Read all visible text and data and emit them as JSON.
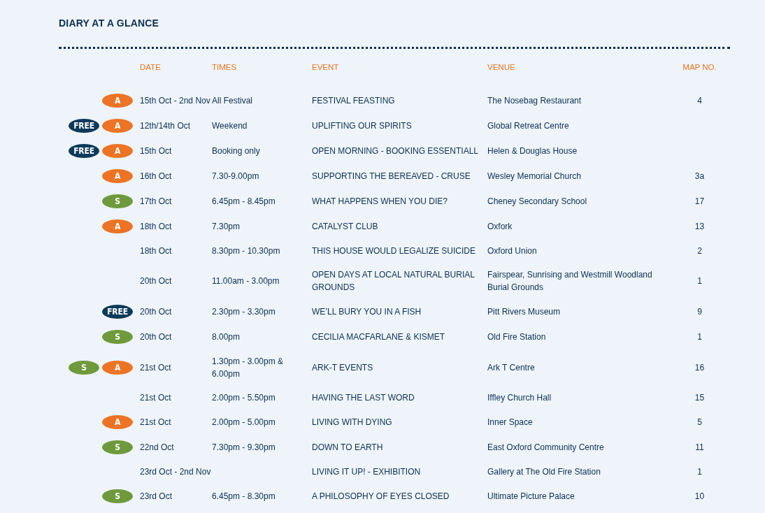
{
  "title": "DIARY AT A GLANCE",
  "columns": [
    "DATE",
    "TIMES",
    "EVENT",
    "VENUE",
    "MAP NO."
  ],
  "rows": [
    {
      "badges": [
        {
          "kind": "arts",
          "label": "A"
        }
      ],
      "date": "15th Oct - 2nd Nov",
      "times": "All Festival",
      "event": "FESTIVAL FEASTING",
      "venue": "The Nosebag Restaurant",
      "map_no": "4"
    },
    {
      "badges": [
        {
          "kind": "free",
          "label": "FREE"
        },
        {
          "kind": "arts",
          "label": "A"
        }
      ],
      "date": "12th/14th Oct",
      "times": "Weekend",
      "event": "UPLIFTING OUR SPIRITS",
      "venue": "Global Retreat Centre",
      "map_no": ""
    },
    {
      "badges": [
        {
          "kind": "free",
          "label": "FREE"
        },
        {
          "kind": "arts",
          "label": "A"
        }
      ],
      "date": "15th Oct",
      "times": "Booking only",
      "event": "OPEN MORNING - BOOKING ESSENTIALL",
      "venue": "Helen & Douglas House",
      "map_no": ""
    },
    {
      "badges": [
        {
          "kind": "arts",
          "label": "A"
        }
      ],
      "date": "16th Oct",
      "times": "7.30-9.00pm",
      "event": "SUPPORTING THE BEREAVED - CRUSE",
      "venue": "Wesley Memorial Church",
      "map_no": "3a"
    },
    {
      "badges": [
        {
          "kind": "science",
          "label": "S"
        }
      ],
      "date": "17th Oct",
      "times": "6.45pm - 8.45pm",
      "event": "WHAT HAPPENS WHEN YOU DIE?",
      "venue": "Cheney Secondary School",
      "map_no": "17"
    },
    {
      "badges": [
        {
          "kind": "arts",
          "label": "A"
        }
      ],
      "date": "18th Oct",
      "times": "7.30pm",
      "event": "CATALYST CLUB",
      "venue": "Oxfork",
      "map_no": "13"
    },
    {
      "badges": [],
      "date": "18th Oct",
      "times": "8.30pm - 10.30pm",
      "event": "THIS HOUSE WOULD LEGALIZE SUICIDE",
      "venue": "Oxford Union",
      "map_no": "2"
    },
    {
      "badges": [],
      "date": "20th Oct",
      "times": "11.00am - 3.00pm",
      "event": "OPEN DAYS AT LOCAL NATURAL BURIAL GROUNDS",
      "venue": "Fairspear, Sunrising and Westmill Woodland Burial Grounds",
      "map_no": "1"
    },
    {
      "badges": [
        {
          "kind": "free",
          "label": "FREE"
        }
      ],
      "date": "20th Oct",
      "times": "2.30pm - 3.30pm",
      "event": "WE’LL BURY YOU IN A FISH",
      "venue": "Pitt Rivers Museum",
      "map_no": "9"
    },
    {
      "badges": [
        {
          "kind": "science",
          "label": "S"
        }
      ],
      "date": "20th Oct",
      "times": "8.00pm",
      "event": "CECILIA MACFARLANE & KISMET",
      "venue": "Old Fire Station",
      "map_no": "1"
    },
    {
      "badges": [
        {
          "kind": "science",
          "label": "S"
        },
        {
          "kind": "arts",
          "label": "A"
        }
      ],
      "date": "21st Oct",
      "times": "1.30pm - 3.00pm & 6.00pm",
      "event": "ARK-T EVENTS",
      "venue": "Ark T Centre",
      "map_no": "16"
    },
    {
      "badges": [],
      "date": "21st Oct",
      "times": "2.00pm - 5.50pm",
      "event": "HAVING THE LAST WORD",
      "venue": "Iffley Church Hall",
      "map_no": "15"
    },
    {
      "badges": [
        {
          "kind": "arts",
          "label": "A"
        }
      ],
      "date": "21st Oct",
      "times": "2.00pm - 5.00pm",
      "event": "LIVING WITH DYING",
      "venue": "Inner Space",
      "map_no": "5"
    },
    {
      "badges": [
        {
          "kind": "science",
          "label": "S"
        }
      ],
      "date": "22nd Oct",
      "times": "7.30pm - 9.30pm",
      "event": "DOWN TO EARTH",
      "venue": "East Oxford Community Centre",
      "map_no": "11"
    },
    {
      "badges": [],
      "date": "23rd Oct - 2nd Nov",
      "times": "",
      "event": "LIVING IT UP! - EXHIBITION",
      "venue": "Gallery at The Old Fire Station",
      "map_no": "1"
    },
    {
      "badges": [
        {
          "kind": "science",
          "label": "S"
        }
      ],
      "date": "23rd Oct",
      "times": "6.45pm - 8.30pm",
      "event": "A PHILOSOPHY OF EYES CLOSED",
      "venue": "Ultimate Picture Palace",
      "map_no": "10"
    }
  ]
}
